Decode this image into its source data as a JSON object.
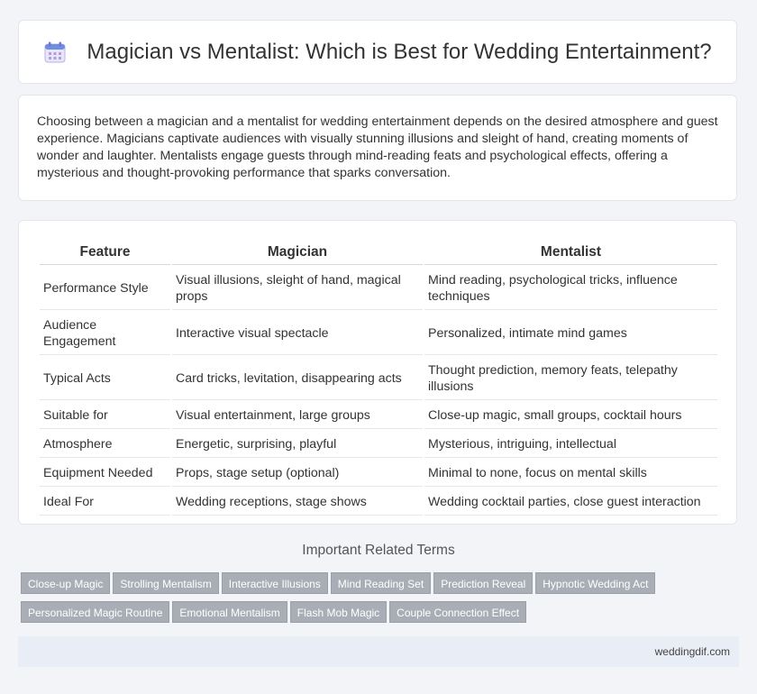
{
  "header": {
    "title": "Magician vs Mentalist: Which is Best for Wedding Entertainment?",
    "icon": "calendar-icon"
  },
  "intro": {
    "text": "Choosing between a magician and a mentalist for wedding entertainment depends on the desired atmosphere and guest experience. Magicians captivate audiences with visually stunning illusions and sleight of hand, creating moments of wonder and laughter. Mentalists engage guests through mind-reading feats and psychological effects, offering a mysterious and thought-provoking performance that sparks conversation."
  },
  "table": {
    "headers": [
      "Feature",
      "Magician",
      "Mentalist"
    ],
    "rows": [
      [
        "Performance Style",
        "Visual illusions, sleight of hand, magical props",
        "Mind reading, psychological tricks, influence techniques"
      ],
      [
        "Audience Engagement",
        "Interactive visual spectacle",
        "Personalized, intimate mind games"
      ],
      [
        "Typical Acts",
        "Card tricks, levitation, disappearing acts",
        "Thought prediction, memory feats, telepathy illusions"
      ],
      [
        "Suitable for",
        "Visual entertainment, large groups",
        "Close-up magic, small groups, cocktail hours"
      ],
      [
        "Atmosphere",
        "Energetic, surprising, playful",
        "Mysterious, intriguing, intellectual"
      ],
      [
        "Equipment Needed",
        "Props, stage setup (optional)",
        "Minimal to none, focus on mental skills"
      ],
      [
        "Ideal For",
        "Wedding receptions, stage shows",
        "Wedding cocktail parties, close guest interaction"
      ]
    ]
  },
  "terms": {
    "title": "Important Related Terms",
    "tags": [
      "Close-up Magic",
      "Strolling Mentalism",
      "Interactive Illusions",
      "Mind Reading Set",
      "Prediction Reveal",
      "Hypnotic Wedding Act",
      "Personalized Magic Routine",
      "Emotional Mentalism",
      "Flash Mob Magic",
      "Couple Connection Effect"
    ]
  },
  "footer": {
    "site": "weddingdif.com"
  }
}
